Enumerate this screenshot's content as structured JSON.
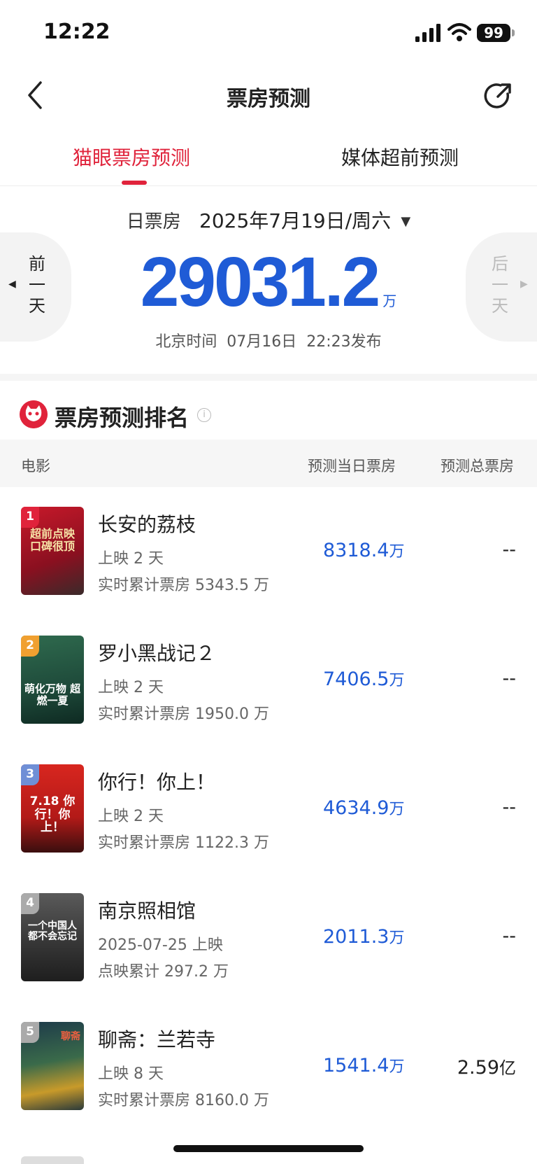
{
  "status_bar": {
    "time": "12:22",
    "battery": "99"
  },
  "nav": {
    "title": "票房预测",
    "back_icon": "chevron-left-icon",
    "share_icon": "share-icon"
  },
  "tabs": [
    {
      "label": "猫眼票房预测",
      "active": true
    },
    {
      "label": "媒体超前预测",
      "active": false
    }
  ],
  "day": {
    "label": "日票房",
    "date": "2025年7月19日/周六",
    "prev_label": "前一天",
    "next_label": "后一天",
    "total": "29031.2",
    "unit": "万",
    "publish_text": "北京时间  07月16日  22:23发布"
  },
  "ranking": {
    "title": "票房预测排名",
    "columns": [
      "电影",
      "预测当日票房",
      "预测总票房"
    ],
    "rows": [
      {
        "rank": "1",
        "name": "长安的荔枝",
        "line1": "上映 2 天",
        "line2": "实时累计票房 5343.5 万",
        "day_value": "8318.4",
        "day_unit": "万",
        "total_value": "--",
        "total_unit": "",
        "poster_text": "超前点映 口碑很顶"
      },
      {
        "rank": "2",
        "name": "罗小黑战记２",
        "line1": "上映 2 天",
        "line2": "实时累计票房 1950.0 万",
        "day_value": "7406.5",
        "day_unit": "万",
        "total_value": "--",
        "total_unit": "",
        "poster_text": "萌化万物 超燃一夏"
      },
      {
        "rank": "3",
        "name": "你行！你上！",
        "line1": "上映 2 天",
        "line2": "实时累计票房 1122.3 万",
        "day_value": "4634.9",
        "day_unit": "万",
        "total_value": "--",
        "total_unit": "",
        "poster_text": "7.18 你行！你上！"
      },
      {
        "rank": "4",
        "name": "南京照相馆",
        "line1": "2025-07-25 上映",
        "line2": "点映累计 297.2 万",
        "day_value": "2011.3",
        "day_unit": "万",
        "total_value": "--",
        "total_unit": "",
        "poster_text": "一个中国人 都不会忘记"
      },
      {
        "rank": "5",
        "name": "聊斋：兰若寺",
        "line1": "上映 8 天",
        "line2": "实时累计票房 8160.0 万",
        "day_value": "1541.4",
        "day_unit": "万",
        "total_value": "2.59",
        "total_unit": "亿",
        "poster_text": "聊斋"
      }
    ]
  },
  "colors": {
    "accent": "#e0233b",
    "value_blue": "#1f5bd6",
    "rank1": "#e0233b",
    "rank2": "#f0a030",
    "rank3": "#6f8fd6",
    "rank_other": "#aaaaaa"
  }
}
